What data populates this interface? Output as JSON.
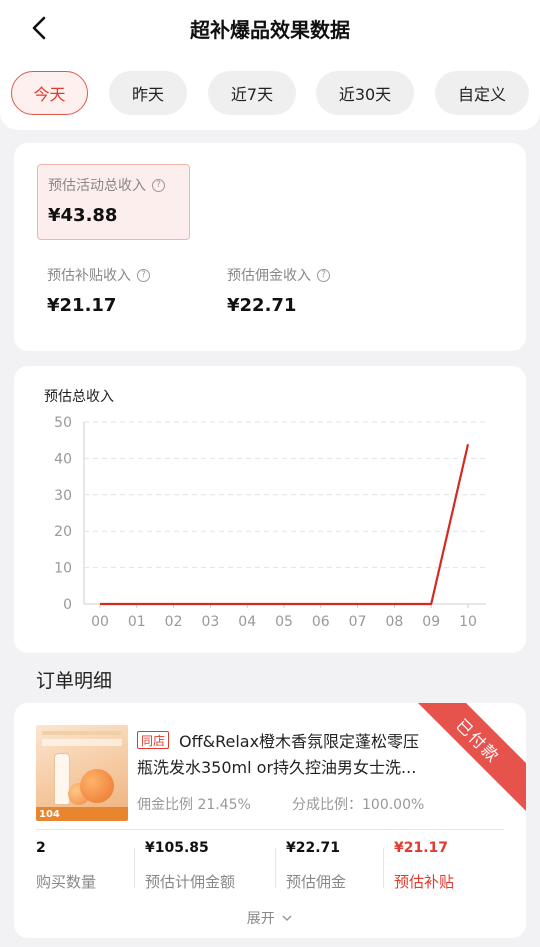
{
  "header": {
    "title": "超补爆品效果数据",
    "back_icon": "chevron-left-icon"
  },
  "tabs": [
    {
      "label": "今天",
      "active": true
    },
    {
      "label": "昨天",
      "active": false
    },
    {
      "label": "近7天",
      "active": false
    },
    {
      "label": "近30天",
      "active": false
    },
    {
      "label": "自定义",
      "active": false
    }
  ],
  "summary": {
    "total_label": "预估活动总收入",
    "total_value": "¥43.88",
    "subsidy_label": "预估补贴收入",
    "subsidy_value": "¥21.17",
    "commission_label": "预估佣金收入",
    "commission_value": "¥22.71"
  },
  "chart_data": {
    "type": "line",
    "title": "预估总收入",
    "categories": [
      "00",
      "01",
      "02",
      "03",
      "04",
      "05",
      "06",
      "07",
      "08",
      "09",
      "10"
    ],
    "series": [
      {
        "values": [
          0,
          0,
          0,
          0,
          0,
          0,
          0,
          0,
          0,
          0,
          43.88
        ]
      }
    ],
    "yticks": [
      "0",
      "10",
      "20",
      "30",
      "40",
      "50"
    ],
    "ylim": [
      0,
      50
    ],
    "grid": true,
    "line_color": "#d42a22"
  },
  "orders": {
    "section_title": "订单明细",
    "items": [
      {
        "status": "已付款",
        "store_tag": "同店",
        "title_line1": "Off&Relax橙木香氛限定蓬松零压",
        "title_line2": "瓶洗发水350ml or持久控油男女士洗...",
        "commission_rate": "佣金比例 21.45%",
        "share_rate": "分成比例：100.00%",
        "thumb_price": "104",
        "stats": [
          {
            "value": "2",
            "label": "购买数量"
          },
          {
            "value": "¥105.85",
            "label": "预估计佣金额"
          },
          {
            "value": "¥22.71",
            "label": "预估佣金"
          },
          {
            "value": "¥21.17",
            "label": "预估补贴"
          }
        ],
        "expand_label": "展开",
        "expand_icon": "chevron-down-icon"
      }
    ]
  },
  "colors": {
    "accent": "#e23a2d",
    "background": "#f2f2f4"
  }
}
